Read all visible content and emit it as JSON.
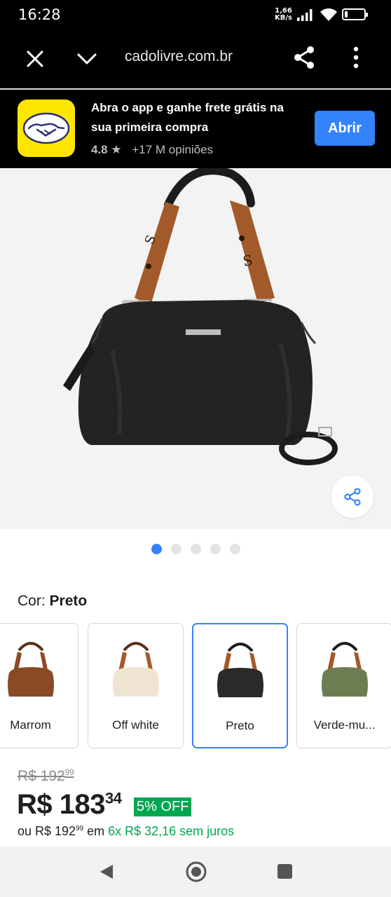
{
  "status_bar": {
    "time": "16:28",
    "speed_value": "1,66",
    "speed_unit": "KB/s",
    "battery": "16",
    "battery_level": 0.16
  },
  "browser": {
    "url": "cadolivre.com.br",
    "close_icon": "close-icon",
    "chevron_icon": "chevron-down-icon",
    "share_icon": "share-icon",
    "menu_icon": "more-vert-icon"
  },
  "app_banner": {
    "line1": "Abra o app e ganhe frete grátis na",
    "line2": "sua primeira compra",
    "rating": "4.8",
    "reviews": "+17 M opiniões",
    "open_label": "Abrir",
    "logo_icon": "handshake-logo-icon"
  },
  "gallery": {
    "image_count": 5,
    "active_index": 0,
    "share_icon": "share-icon"
  },
  "color_selector": {
    "label": "Cor: ",
    "selected": "Preto",
    "variants": [
      {
        "label": "Marrom",
        "color": "#8b4a26"
      },
      {
        "label": "Off white",
        "color": "#efe4d2"
      },
      {
        "label": "Preto",
        "color": "#2a2a2a"
      },
      {
        "label": "Verde-mu...",
        "color": "#6d7d52"
      }
    ]
  },
  "price": {
    "old_main": "R$ 192",
    "old_cents": "99",
    "currency": "R$",
    "main": "183",
    "cents": "34",
    "discount": "5% OFF",
    "install_prefix": "ou R$ 192",
    "install_cents": "99",
    "install_mid": " em ",
    "install_plan": "6x R$ 32,16 sem juros"
  },
  "colors": {
    "accent": "#3483fa",
    "discount_green": "#00a650",
    "brand_yellow": "#ffe600"
  }
}
